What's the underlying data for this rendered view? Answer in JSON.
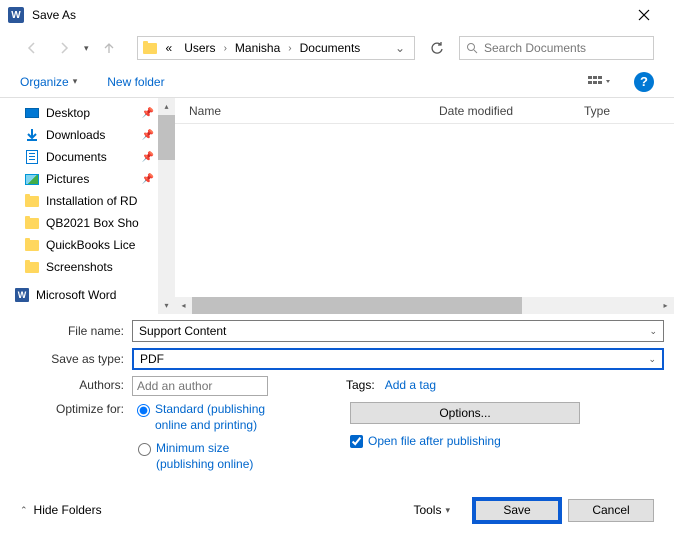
{
  "title": "Save As",
  "breadcrumb": {
    "root_symbol": "«",
    "parts": [
      "Users",
      "Manisha",
      "Documents"
    ]
  },
  "search": {
    "placeholder": "Search Documents"
  },
  "toolbar": {
    "organize": "Organize",
    "new_folder": "New folder"
  },
  "sidebar": {
    "items": [
      {
        "label": "Desktop",
        "pinned": true,
        "icon": "desktop"
      },
      {
        "label": "Downloads",
        "pinned": true,
        "icon": "download"
      },
      {
        "label": "Documents",
        "pinned": true,
        "icon": "doc"
      },
      {
        "label": "Pictures",
        "pinned": true,
        "icon": "pic"
      },
      {
        "label": "Installation of RD",
        "pinned": false,
        "icon": "folder"
      },
      {
        "label": "QB2021 Box Sho",
        "pinned": false,
        "icon": "folder"
      },
      {
        "label": "QuickBooks Lice",
        "pinned": false,
        "icon": "folder"
      },
      {
        "label": "Screenshots",
        "pinned": false,
        "icon": "folder"
      }
    ],
    "footer": {
      "label": "Microsoft Word",
      "icon": "word"
    }
  },
  "columns": {
    "name": "Name",
    "date": "Date modified",
    "type": "Type"
  },
  "form": {
    "filename_label": "File name:",
    "filename_value": "Support Content",
    "savetype_label": "Save as type:",
    "savetype_value": "PDF",
    "authors_label": "Authors:",
    "authors_placeholder": "Add an author",
    "tags_label": "Tags:",
    "tags_link": "Add a tag",
    "optimize_label": "Optimize for:",
    "opt_standard": "Standard (publishing online and printing)",
    "opt_minimum": "Minimum size (publishing online)",
    "options_btn": "Options...",
    "open_after": "Open file after publishing"
  },
  "footer": {
    "hide_folders": "Hide Folders",
    "tools": "Tools",
    "save": "Save",
    "cancel": "Cancel"
  }
}
